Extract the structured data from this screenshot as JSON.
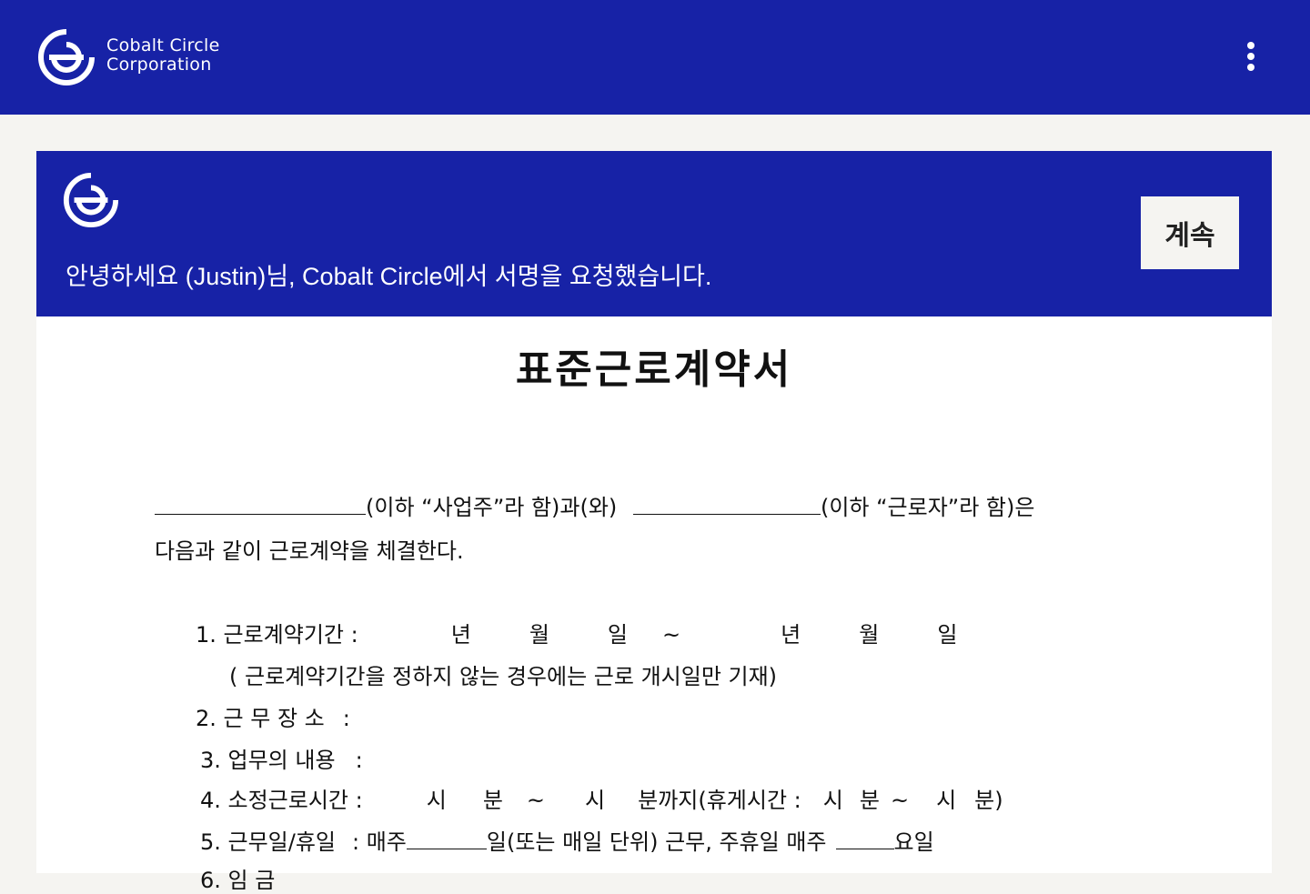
{
  "header": {
    "brand_line1": "Cobalt Circle",
    "brand_line2": "Corporation",
    "logo_icon": "cobalt-circle-logo-icon",
    "menu_icon": "kebab-menu-icon"
  },
  "banner": {
    "message": "안녕하세요 (Justin)님, Cobalt Circle에서 서명을 요청했습니다.",
    "continue_label": "계속"
  },
  "document": {
    "title": "표준근로계약서",
    "intro": {
      "employer_suffix": "(이하 “사업주”라 함)과(와)",
      "worker_suffix": "(이하 “근로자”라 함)은",
      "line2": "다음과 같이 근로계약을 체결한다."
    },
    "items": {
      "item1_label": "1. 근로계약기간 :",
      "year": "년",
      "month": "월",
      "day": "일",
      "tilde": "~",
      "item1_note": "( 근로계약기간을 정하지 않는 경우에는 근로 개시일만 기재)",
      "item2_label": "2. 근 무 장 소",
      "colon": ":",
      "item3_label": "3. 업무의 내용",
      "item4_label": "4. 소정근로시간 :",
      "hour": "시",
      "minute": "분",
      "until_break": "분까지(휴게시간 :",
      "close_minute": "분)",
      "item5_label": "5. 근무일/휴일",
      "item5_weekly": ": 매주",
      "item5_mid": "일(또는 매일 단위) 근무, 주휴일 매주",
      "item5_end": "요일",
      "item6_partial": "6. 임      금"
    }
  },
  "colors": {
    "cobalt": "#1722a6",
    "page_bg": "#f5f4f1",
    "doc_bg": "#ffffff"
  }
}
